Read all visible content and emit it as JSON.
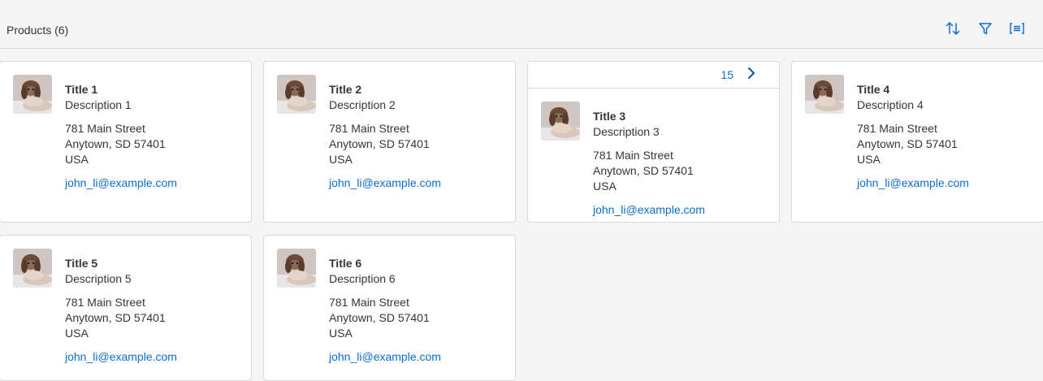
{
  "toolbar": {
    "title": "Products (6)",
    "icons": [
      "sort-icon",
      "filter-icon",
      "group-icon"
    ],
    "accent": "#0a6ed1"
  },
  "cards": [
    {
      "title": "Title 1",
      "description": "Description 1",
      "street": "781 Main Street",
      "city": "Anytown, SD 57401",
      "country": "USA",
      "email": "john_li@example.com"
    },
    {
      "title": "Title 2",
      "description": "Description 2",
      "street": "781 Main Street",
      "city": "Anytown, SD 57401",
      "country": "USA",
      "email": "john_li@example.com"
    },
    {
      "title": "Title 3",
      "description": "Description 3",
      "street": "781 Main Street",
      "city": "Anytown, SD 57401",
      "country": "USA",
      "email": "john_li@example.com",
      "header_count": "15"
    },
    {
      "title": "Title 4",
      "description": "Description 4",
      "street": "781 Main Street",
      "city": "Anytown, SD 57401",
      "country": "USA",
      "email": "john_li@example.com"
    },
    {
      "title": "Title 5",
      "description": "Description 5",
      "street": "781 Main Street",
      "city": "Anytown, SD 57401",
      "country": "USA",
      "email": "john_li@example.com"
    },
    {
      "title": "Title 6",
      "description": "Description 6",
      "street": "781 Main Street",
      "city": "Anytown, SD 57401",
      "country": "USA",
      "email": "john_li@example.com"
    }
  ]
}
